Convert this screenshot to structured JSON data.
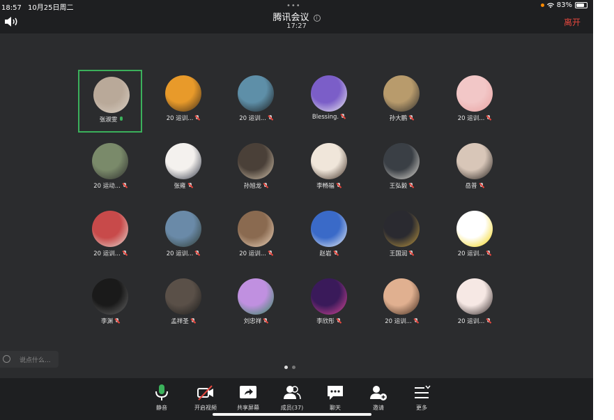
{
  "status_bar": {
    "time": "18:57",
    "date": "10月25日周二",
    "battery": "83%"
  },
  "header": {
    "title": "腾讯会议",
    "time": "17:27",
    "leave_label": "离开"
  },
  "participants": [
    {
      "name": "张淑雯",
      "mic": "on",
      "active": true,
      "colors": [
        "#b9a999",
        "#d9cfc4"
      ]
    },
    {
      "name": "20 运训...",
      "mic": "muted",
      "colors": [
        "#e89a2a",
        "#3a2a1a"
      ]
    },
    {
      "name": "20 运训...",
      "mic": "muted",
      "colors": [
        "#5e8fa8",
        "#1a1a1a"
      ]
    },
    {
      "name": "Blessing.",
      "mic": "muted",
      "colors": [
        "#7b5ec8",
        "#f2f2f2"
      ]
    },
    {
      "name": "孙大鹏",
      "mic": "muted",
      "colors": [
        "#b89b6c",
        "#2a2a2a"
      ]
    },
    {
      "name": "20 运训...",
      "mic": "muted",
      "colors": [
        "#f2c7c7",
        "#e8a0a0"
      ]
    },
    {
      "name": "20 运动...",
      "mic": "muted",
      "colors": [
        "#7a8a6a",
        "#2b2b2b"
      ]
    },
    {
      "name": "张雍",
      "mic": "muted",
      "colors": [
        "#f4f1ee",
        "#2a3040"
      ]
    },
    {
      "name": "孙旭龙",
      "mic": "muted",
      "colors": [
        "#4a4038",
        "#d8c8b0"
      ]
    },
    {
      "name": "李畅福",
      "mic": "muted",
      "colors": [
        "#f0e6da",
        "#3a2a20"
      ]
    },
    {
      "name": "王弘毅",
      "mic": "muted",
      "colors": [
        "#3a3f45",
        "#e8e4dc"
      ]
    },
    {
      "name": "岳普",
      "mic": "muted",
      "colors": [
        "#d8c6b8",
        "#1e1a18"
      ]
    },
    {
      "name": "20 运训...",
      "mic": "muted",
      "colors": [
        "#c84a4a",
        "#e8e0d8"
      ]
    },
    {
      "name": "20 运训...",
      "mic": "muted",
      "colors": [
        "#6a8aa8",
        "#2e3a30"
      ]
    },
    {
      "name": "20 运训...",
      "mic": "muted",
      "colors": [
        "#8a6a50",
        "#f0d8c0"
      ]
    },
    {
      "name": "赵岩",
      "mic": "muted",
      "colors": [
        "#3a6ac8",
        "#f0f4f8"
      ]
    },
    {
      "name": "王国润",
      "mic": "muted",
      "colors": [
        "#2a2a30",
        "#c8a040"
      ]
    },
    {
      "name": "20 运训...",
      "mic": "muted",
      "colors": [
        "#ffffff",
        "#f2d000"
      ]
    },
    {
      "name": "李渊",
      "mic": "muted",
      "colors": [
        "#1a1a1a",
        "#6a6a6a"
      ]
    },
    {
      "name": "孟祥圣",
      "mic": "muted",
      "colors": [
        "#5a5048",
        "#1a1a1a"
      ]
    },
    {
      "name": "刘忠祥",
      "mic": "muted",
      "colors": [
        "#c090e0",
        "#2e8a5a"
      ]
    },
    {
      "name": "李欣彤",
      "mic": "muted",
      "colors": [
        "#3a1a5a",
        "#e04a9a"
      ]
    },
    {
      "name": "20 运训...",
      "mic": "muted",
      "colors": [
        "#e0b090",
        "#3a2418"
      ]
    },
    {
      "name": "20 运训...",
      "mic": "muted",
      "colors": [
        "#f6e8e4",
        "#2a2020"
      ]
    }
  ],
  "chat": {
    "placeholder": "说点什么..."
  },
  "toolbar": {
    "items": [
      {
        "label": "静音",
        "icon": "microphone-icon"
      },
      {
        "label": "开启视频",
        "icon": "video-off-icon"
      },
      {
        "label": "共享屏幕",
        "icon": "share-screen-icon"
      },
      {
        "label": "成员(37)",
        "icon": "members-icon"
      },
      {
        "label": "聊天",
        "icon": "chat-icon"
      },
      {
        "label": "邀请",
        "icon": "invite-icon"
      },
      {
        "label": "更多",
        "icon": "more-icon"
      }
    ]
  },
  "colors": {
    "accent_red": "#e5473e",
    "active_green": "#3bb15b"
  }
}
